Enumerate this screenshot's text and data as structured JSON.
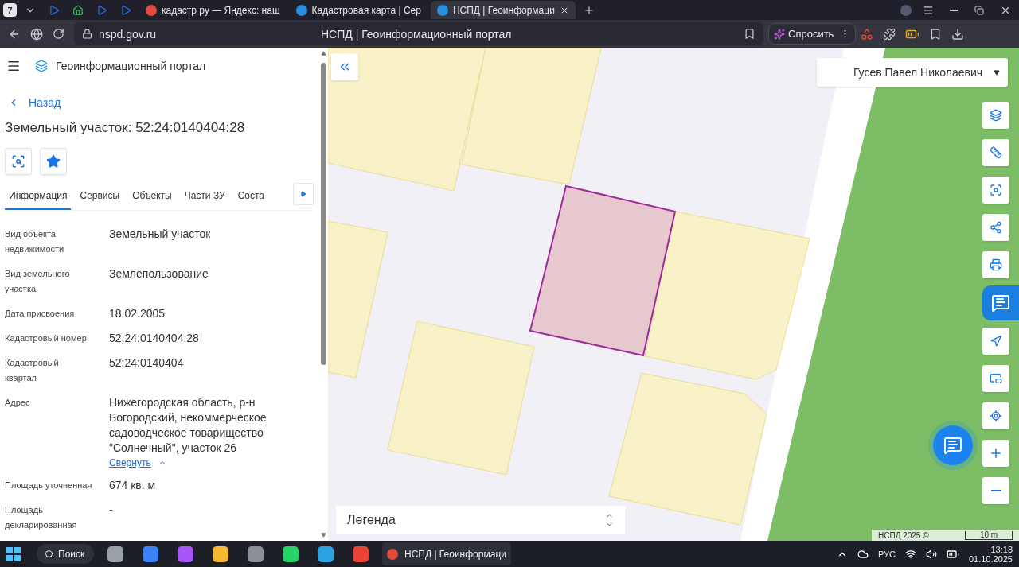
{
  "browser": {
    "tab_count": "7",
    "tabs": [
      {
        "label": "кадастр ру — Яндекс: наш",
        "selected": false
      },
      {
        "label": "Кадастровая карта | Сер",
        "selected": false
      },
      {
        "label": "НСПД | Геоинформаци",
        "selected": true
      }
    ],
    "address": "nspd.gov.ru",
    "page_title": "НСПД | Геоинформационный портал",
    "ask_button": "Спросить"
  },
  "sidebar": {
    "portal_title": "Геоинформационный портал",
    "back": "Назад",
    "heading": "Земельный участок: 52:24:0140404:28",
    "tabs": [
      {
        "label": "Информация",
        "selected": true
      },
      {
        "label": "Сервисы",
        "selected": false
      },
      {
        "label": "Объекты",
        "selected": false
      },
      {
        "label": "Части ЗУ",
        "selected": false
      },
      {
        "label": "Соста",
        "selected": false
      }
    ],
    "fields": [
      {
        "label": "Вид объекта недвижимости",
        "value": "Земельный участок"
      },
      {
        "label": "Вид земельного участка",
        "value": "Землепользование"
      },
      {
        "label": "Дата присвоения",
        "value": "18.02.2005"
      },
      {
        "label": "Кадастровый номер",
        "value": "52:24:0140404:28"
      },
      {
        "label": "Кадастровый квартал",
        "value": "52:24:0140404"
      },
      {
        "label": "Адрес",
        "value": "Нижегородская область, р-н Богородский, некоммерческое садоводческое товарищество \"Солнечный\", участок 26",
        "link": "Свернуть"
      },
      {
        "label": "Площадь уточненная",
        "value": "674 кв. м"
      },
      {
        "label": "Площадь декларированная",
        "value": "-"
      }
    ]
  },
  "map": {
    "user": "Гусев Павел Николаевич",
    "legend": "Легенда",
    "attribution": "НСПД 2025 ©",
    "scale": "10 m"
  },
  "taskbar": {
    "search": "Поиск",
    "app": "НСПД | Геоинформаци",
    "language": "РУС",
    "time": "13:18",
    "date": "01.10.2025"
  }
}
